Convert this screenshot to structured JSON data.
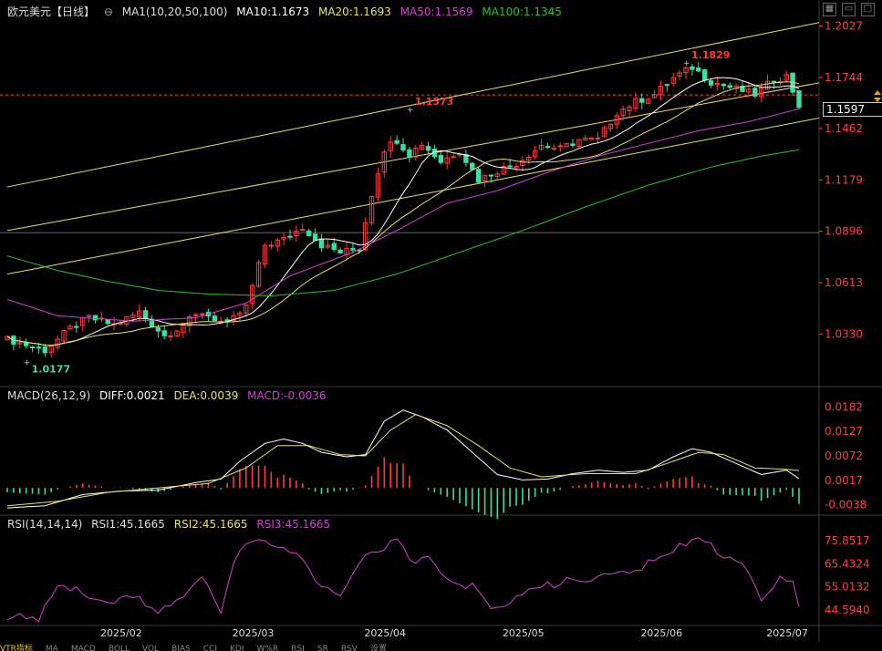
{
  "header": {
    "symbol": "欧元美元【日线】",
    "ma_title": "MA1(10,20,50,100)",
    "ma10": "MA10:1.1673",
    "ma20": "MA20:1.1693",
    "ma50": "MA50:1.1569",
    "ma100": "MA100:1.1345"
  },
  "macd_header": {
    "title": "MACD(26,12,9)",
    "diff": "DIFF:0.0021",
    "dea": "DEA:0.0039",
    "macd": "MACD:-0.0036"
  },
  "rsi_header": {
    "title": "RSI(14,14,14)",
    "rsi1": "RSI1:45.1665",
    "rsi2": "RSI2:45.1665",
    "rsi3": "RSI3:45.1665"
  },
  "current_price": "1.1597",
  "tabs": [
    "VTR指标",
    "MA",
    "MACD",
    "BOLL",
    "VOL",
    "BIAS",
    "CCI",
    "KDJ",
    "W%R",
    "RSI",
    "SR",
    "RSV",
    "设置"
  ],
  "colors": {
    "up": "#ff3b3b",
    "down": "#3ddfa0",
    "ma10": "#ffffff",
    "ma20": "#e8e070",
    "ma50": "#d640d6",
    "ma100": "#2ec02e",
    "trend": "#e8e070",
    "axis_text": "#ff4040"
  },
  "chart_data": [
    {
      "type": "candlestick",
      "title": "欧元美元【日线】",
      "y_ticks": [
        "1.2027",
        "1.1744",
        "1.1462",
        "1.1179",
        "1.0896",
        "1.0613",
        "1.0330"
      ],
      "ylim": [
        1.006,
        1.208
      ],
      "x_ticks": [
        "2025/02",
        "2025/03",
        "2025/04",
        "2025/05",
        "2025/06",
        "2025/07"
      ],
      "annotations": [
        {
          "text": "1.0177",
          "value": 1.0177
        },
        {
          "text": "1.1573",
          "value": 1.1573
        },
        {
          "text": "1.1829",
          "value": 1.1829
        }
      ],
      "current_price": 1.1597,
      "ma_last": {
        "MA10": 1.1673,
        "MA20": 1.1693,
        "MA50": 1.1569,
        "MA100": 1.1345
      },
      "close_path": [
        [
          0,
          1.03
        ],
        [
          6,
          1.024
        ],
        [
          10,
          1.036
        ],
        [
          13,
          1.042
        ],
        [
          17,
          1.038
        ],
        [
          21,
          1.045
        ],
        [
          25,
          1.032
        ],
        [
          27,
          1.036
        ],
        [
          31,
          1.045
        ],
        [
          35,
          1.038
        ],
        [
          38,
          1.048
        ],
        [
          41,
          1.082
        ],
        [
          44,
          1.085
        ],
        [
          47,
          1.092
        ],
        [
          50,
          1.082
        ],
        [
          53,
          1.078
        ],
        [
          56,
          1.08
        ],
        [
          58,
          1.11
        ],
        [
          60,
          1.135
        ],
        [
          62,
          1.14
        ],
        [
          64,
          1.132
        ],
        [
          66,
          1.138
        ],
        [
          69,
          1.128
        ],
        [
          72,
          1.134
        ],
        [
          75,
          1.118
        ],
        [
          78,
          1.123
        ],
        [
          81,
          1.127
        ],
        [
          85,
          1.137
        ],
        [
          88,
          1.135
        ],
        [
          91,
          1.14
        ],
        [
          94,
          1.14
        ],
        [
          97,
          1.155
        ],
        [
          100,
          1.161
        ],
        [
          103,
          1.165
        ],
        [
          106,
          1.174
        ],
        [
          109,
          1.18
        ],
        [
          112,
          1.172
        ],
        [
          116,
          1.168
        ],
        [
          119,
          1.165
        ],
        [
          122,
          1.173
        ],
        [
          124,
          1.175
        ],
        [
          126,
          1.159
        ]
      ]
    },
    {
      "type": "macd",
      "title": "MACD(26,12,9)",
      "y_ticks": [
        "0.0182",
        "0.0127",
        "0.0072",
        "0.0017",
        "-0.0038"
      ],
      "ylim": [
        -0.0055,
        0.0195
      ],
      "diff_path": [
        [
          0,
          -0.0045
        ],
        [
          6,
          -0.004
        ],
        [
          12,
          -0.0015
        ],
        [
          18,
          -0.0007
        ],
        [
          24,
          -0.0005
        ],
        [
          30,
          0.0012
        ],
        [
          34,
          0.002
        ],
        [
          37,
          0.006
        ],
        [
          41,
          0.01
        ],
        [
          44,
          0.011
        ],
        [
          47,
          0.01
        ],
        [
          50,
          0.008
        ],
        [
          54,
          0.007
        ],
        [
          57,
          0.0075
        ],
        [
          60,
          0.015
        ],
        [
          63,
          0.0175
        ],
        [
          66,
          0.016
        ],
        [
          70,
          0.013
        ],
        [
          74,
          0.008
        ],
        [
          78,
          0.003
        ],
        [
          82,
          0.0018
        ],
        [
          86,
          0.002
        ],
        [
          90,
          0.0032
        ],
        [
          94,
          0.004
        ],
        [
          98,
          0.0035
        ],
        [
          102,
          0.004
        ],
        [
          106,
          0.007
        ],
        [
          109,
          0.0088
        ],
        [
          112,
          0.008
        ],
        [
          116,
          0.0055
        ],
        [
          120,
          0.003
        ],
        [
          124,
          0.004
        ],
        [
          126,
          0.0021
        ]
      ],
      "dea_path": [
        [
          0,
          -0.004
        ],
        [
          8,
          -0.003
        ],
        [
          16,
          -0.001
        ],
        [
          24,
          0.0
        ],
        [
          32,
          0.001
        ],
        [
          38,
          0.0045
        ],
        [
          43,
          0.0095
        ],
        [
          48,
          0.0095
        ],
        [
          53,
          0.0075
        ],
        [
          57,
          0.0072
        ],
        [
          61,
          0.013
        ],
        [
          65,
          0.0165
        ],
        [
          70,
          0.014
        ],
        [
          75,
          0.0095
        ],
        [
          80,
          0.0045
        ],
        [
          85,
          0.0025
        ],
        [
          92,
          0.0032
        ],
        [
          100,
          0.0032
        ],
        [
          105,
          0.0055
        ],
        [
          110,
          0.008
        ],
        [
          114,
          0.0075
        ],
        [
          119,
          0.0045
        ],
        [
          124,
          0.0042
        ],
        [
          126,
          0.0039
        ]
      ]
    },
    {
      "type": "line",
      "title": "RSI(14,14,14)",
      "series": [
        {
          "name": "RSI1",
          "color": "#d640d6"
        }
      ],
      "y_ticks": [
        "75.8517",
        "65.4324",
        "55.0132",
        "44.5940"
      ],
      "ylim": [
        38,
        80
      ],
      "rsi_path": [
        [
          0,
          42
        ],
        [
          5,
          40
        ],
        [
          8,
          55
        ],
        [
          12,
          53
        ],
        [
          16,
          47
        ],
        [
          20,
          51
        ],
        [
          24,
          44
        ],
        [
          27,
          48
        ],
        [
          31,
          58
        ],
        [
          34,
          45
        ],
        [
          37,
          73
        ],
        [
          40,
          76
        ],
        [
          43,
          74
        ],
        [
          47,
          67
        ],
        [
          50,
          54
        ],
        [
          53,
          51
        ],
        [
          56,
          66
        ],
        [
          58,
          70
        ],
        [
          60,
          73
        ],
        [
          62,
          77
        ],
        [
          64,
          66
        ],
        [
          67,
          67
        ],
        [
          70,
          58
        ],
        [
          74,
          55
        ],
        [
          77,
          44
        ],
        [
          80,
          49
        ],
        [
          84,
          55
        ],
        [
          88,
          57
        ],
        [
          92,
          58
        ],
        [
          96,
          60
        ],
        [
          100,
          62
        ],
        [
          104,
          69
        ],
        [
          108,
          74
        ],
        [
          110,
          77
        ],
        [
          113,
          71
        ],
        [
          117,
          66
        ],
        [
          120,
          48
        ],
        [
          123,
          60
        ],
        [
          125,
          59
        ],
        [
          126,
          45.17
        ]
      ]
    }
  ]
}
